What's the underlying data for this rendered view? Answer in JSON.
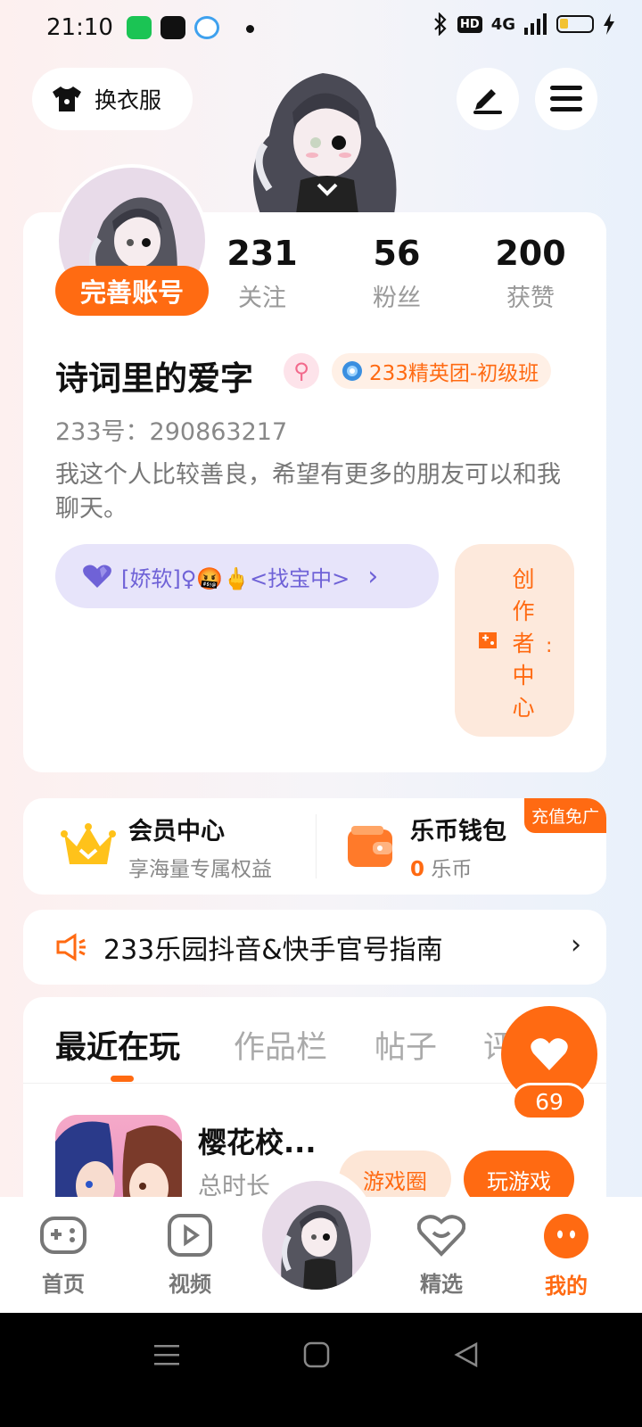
{
  "status_bar": {
    "time": "21:10",
    "hd": "HD",
    "network": "4G",
    "icons": [
      "iqiyi-icon",
      "tiktok-icon",
      "app-icon",
      "bluetooth-icon",
      "signal-icon",
      "battery-icon",
      "charging-icon"
    ]
  },
  "top_bar": {
    "wardrobe_label": "换衣服",
    "edit_icon": "pen-icon",
    "menu_icon": "menu-icon"
  },
  "profile": {
    "complete_label": "完善账号",
    "stats": [
      {
        "num": "231",
        "label": "关注"
      },
      {
        "num": "56",
        "label": "粉丝"
      },
      {
        "num": "200",
        "label": "获赞"
      }
    ],
    "nickname": "诗词里的爱字",
    "gender_symbol": "⚲",
    "title_badge": "233精英团-初级班",
    "uid": "233号：290863217",
    "bio": "我这个人比较善良，希望有更多的朋友可以和我聊天。",
    "mood": "[娇软]♀🤬🖕<找宝中>",
    "mood_arrow": "›",
    "creator_center": "创作者中心",
    "creator_suffix": ":"
  },
  "member": {
    "vip_title": "会员中心",
    "vip_sub": "享海量专属权益",
    "wallet_title": "乐币钱包",
    "wallet_amount": "0",
    "wallet_unit": "乐币",
    "recharge_tag": "充值免广"
  },
  "notice": {
    "text": "233乐园抖音&快手官号指南",
    "arrow": "›"
  },
  "tabs": [
    "最近在玩",
    "作品栏",
    "帖子",
    "评"
  ],
  "recent_game": {
    "name": "樱花校...",
    "sub": "总时长",
    "circle_label": "游戏圈",
    "play_label": "玩游戏"
  },
  "like": {
    "count": "69"
  },
  "bottom_nav": [
    {
      "label": "首页",
      "icon": "gamepad-icon"
    },
    {
      "label": "视频",
      "icon": "video-icon"
    },
    {
      "label": "精选",
      "icon": "heart-diamond-icon"
    },
    {
      "label": "我的",
      "icon": "face-icon"
    }
  ],
  "colors": {
    "accent": "#ff6a12",
    "mood_bg": "#e7e4fa",
    "mood_text": "#6f62d7"
  }
}
